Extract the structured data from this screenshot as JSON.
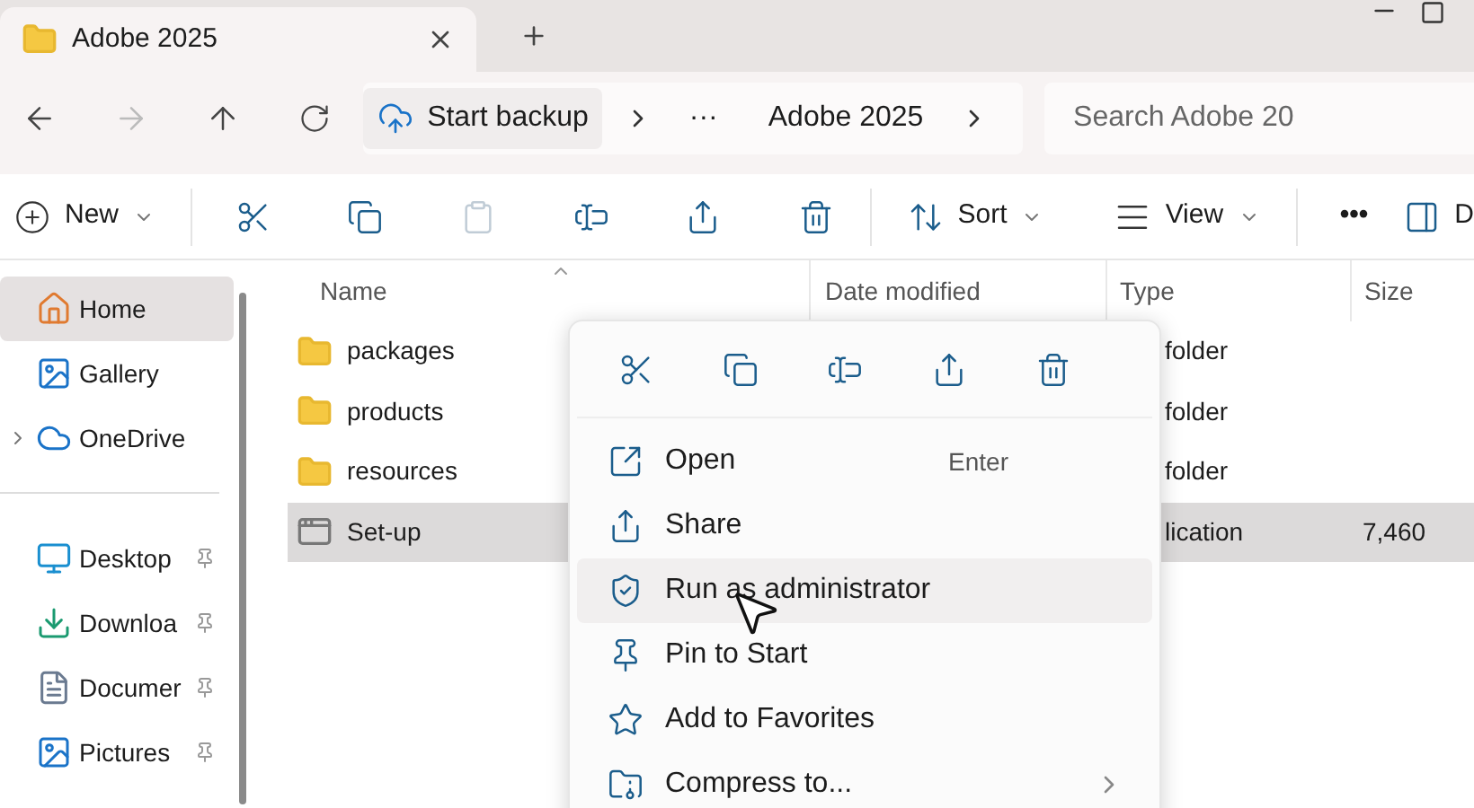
{
  "tab": {
    "title": "Adobe 2025"
  },
  "address": {
    "backup": "Start backup",
    "more": "···",
    "crumbs": [
      "Adobe 2025"
    ]
  },
  "search": {
    "placeholder": "Search Adobe 20"
  },
  "toolbar": {
    "new": "New",
    "sort": "Sort",
    "view": "View",
    "more": "•••",
    "details": "D"
  },
  "sidebar": {
    "groups": [
      [
        {
          "label": "Home",
          "selected": true,
          "pinned": false,
          "expandable": false
        },
        {
          "label": "Gallery",
          "selected": false,
          "pinned": false,
          "expandable": false
        },
        {
          "label": "OneDrive",
          "selected": false,
          "pinned": false,
          "expandable": true
        }
      ],
      [
        {
          "label": "Desktop",
          "selected": false,
          "pinned": true,
          "expandable": false
        },
        {
          "label": "Downloa",
          "selected": false,
          "pinned": true,
          "expandable": false
        },
        {
          "label": "Documer",
          "selected": false,
          "pinned": true,
          "expandable": false
        },
        {
          "label": "Pictures",
          "selected": false,
          "pinned": true,
          "expandable": false
        }
      ]
    ]
  },
  "columns": [
    "Name",
    "Date modified",
    "Type",
    "Size"
  ],
  "rows": [
    {
      "name": "packages",
      "kind": "folder",
      "type": "folder",
      "selected": false
    },
    {
      "name": "products",
      "kind": "folder",
      "type": "folder",
      "selected": false
    },
    {
      "name": "resources",
      "kind": "folder",
      "type": "folder",
      "selected": false
    },
    {
      "name": "Set-up",
      "kind": "app",
      "type": "lication",
      "size": "7,460",
      "selected": true
    }
  ],
  "context_menu": {
    "items": [
      {
        "label": "Open",
        "shortcut": "Enter",
        "submenu": false,
        "selected": false
      },
      {
        "label": "Share",
        "submenu": false,
        "selected": false
      },
      {
        "label": "Run as administrator",
        "submenu": false,
        "selected": true
      },
      {
        "label": "Pin to Start",
        "submenu": false,
        "selected": false
      },
      {
        "label": "Add to Favorites",
        "submenu": false,
        "selected": false
      },
      {
        "label": "Compress to...",
        "submenu": true,
        "selected": false
      }
    ]
  }
}
